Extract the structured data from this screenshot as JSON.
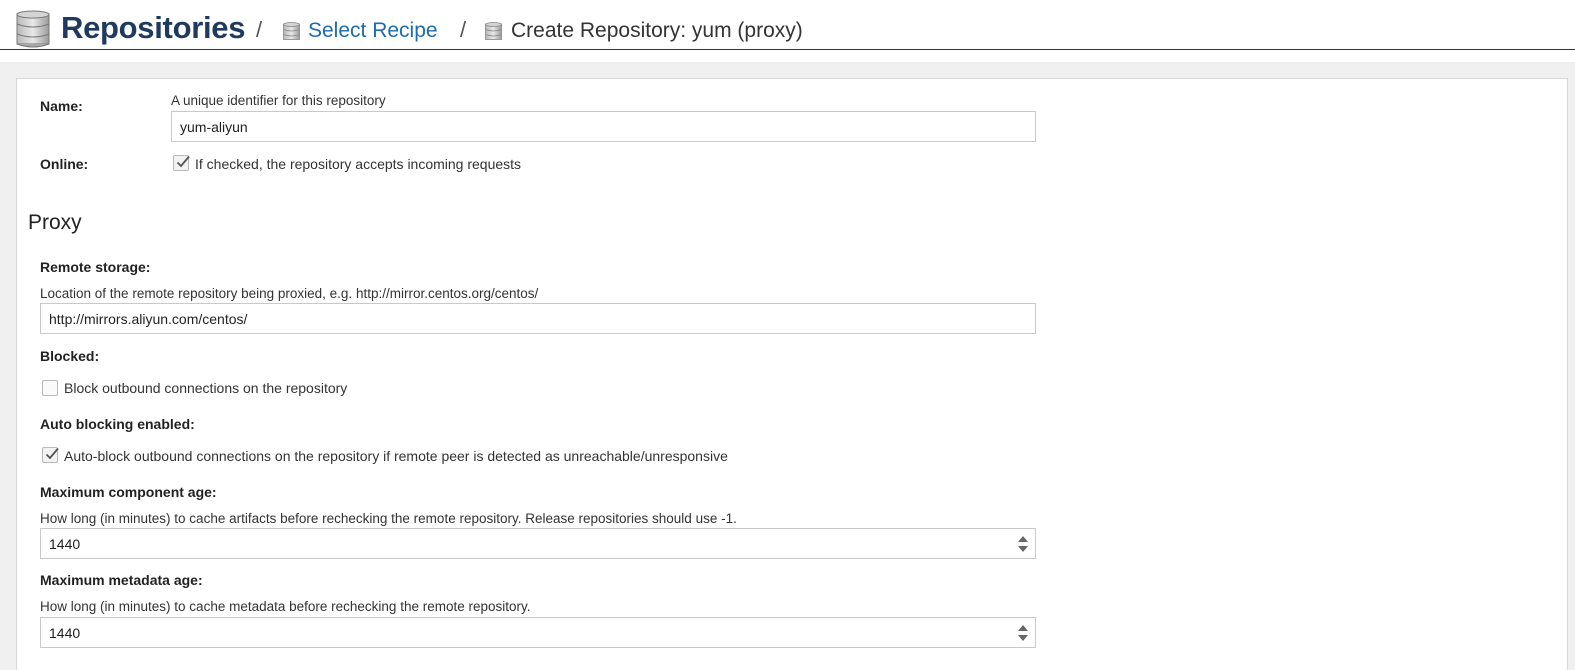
{
  "breadcrumb": {
    "title": "Repositories",
    "separator": "/",
    "link": "Select Recipe",
    "current": "Create Repository: yum (proxy)"
  },
  "form": {
    "name": {
      "label": "Name:",
      "help": "A unique identifier for this repository",
      "value": "yum-aliyun"
    },
    "online": {
      "label": "Online:",
      "checked": true,
      "text": "If checked, the repository accepts incoming requests"
    }
  },
  "proxy": {
    "heading": "Proxy",
    "remote_storage": {
      "label": "Remote storage:",
      "help": "Location of the remote repository being proxied, e.g. http://mirror.centos.org/centos/",
      "value": "http://mirrors.aliyun.com/centos/"
    },
    "blocked": {
      "label": "Blocked:",
      "checked": false,
      "text": "Block outbound connections on the repository"
    },
    "auto_blocking": {
      "label": "Auto blocking enabled:",
      "checked": true,
      "text": "Auto-block outbound connections on the repository if remote peer is detected as unreachable/unresponsive"
    },
    "max_component_age": {
      "label": "Maximum component age:",
      "help": "How long (in minutes) to cache artifacts before rechecking the remote repository. Release repositories should use -1.",
      "value": "1440"
    },
    "max_metadata_age": {
      "label": "Maximum metadata age:",
      "help": "How long (in minutes) to cache metadata before rechecking the remote repository.",
      "value": "1440"
    }
  },
  "icons": {
    "breadcrumb_root": "database-icon",
    "breadcrumb_step": "database-icon",
    "checkbox_mark": "checkmark-icon",
    "spinner": "spinner-arrows-icon"
  },
  "colors": {
    "title": "#1f3a5e",
    "link": "#1e6bb0",
    "frame": "#f0f0f0",
    "border": "#c9c9c9"
  }
}
